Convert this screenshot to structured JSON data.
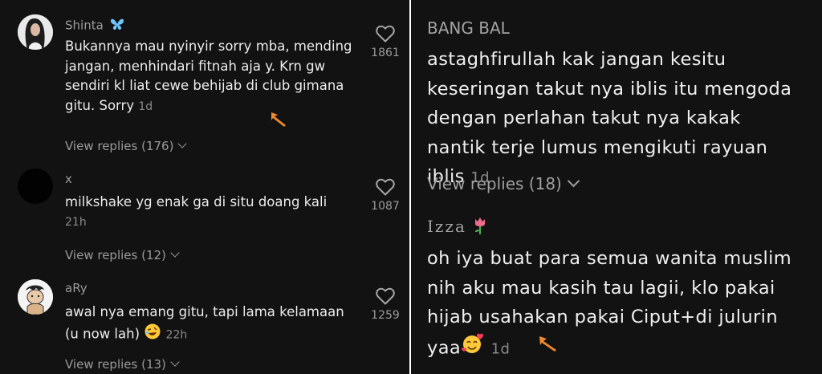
{
  "left_comments": [
    {
      "username": "Shinta",
      "username_icon": "butterfly-icon",
      "text": "Bukannya mau nyinyir sorry mba, mending jangan, menhindari fitnah aja y. Krn gw sendiri kl liat cewe behijab di club gimana gitu. Sorry",
      "date": "1d",
      "likes": "1861",
      "view_replies": "View replies (176)"
    },
    {
      "username": "x",
      "text": "milkshake yg enak ga di situ doang kali",
      "date": "21h",
      "likes": "1087",
      "view_replies": "View replies (12)"
    },
    {
      "username": "aRy",
      "text": "awal nya emang gitu, tapi lama kelamaan (u now lah)",
      "text_emoji": "rofl-emoji",
      "date": "22h",
      "likes": "1259",
      "view_replies": "View replies (13)"
    }
  ],
  "right_comments": [
    {
      "username": "BANG BAL",
      "text": "astaghfirullah kak jangan kesitu keseringan takut nya iblis itu mengoda dengan perlahan takut nya kakak nantik terje lumus mengikuti rayuan iblis",
      "date": "1d",
      "view_replies": "View replies (18)"
    },
    {
      "username": "Izza",
      "username_icon": "tulip-icon",
      "text": "oh iya buat para semua wanita muslim nih aku mau kasih tau lagii, klo pakai hijab usahakan pakai Ciput+di julurin yaa",
      "text_emoji": "smiling-face-with-hearts-emoji",
      "date": "1d"
    }
  ],
  "colors": {
    "background": "#121212",
    "annotation_arrow": "#f08a2c",
    "text_primary": "#ececec",
    "text_secondary": "#9b9b9b"
  }
}
